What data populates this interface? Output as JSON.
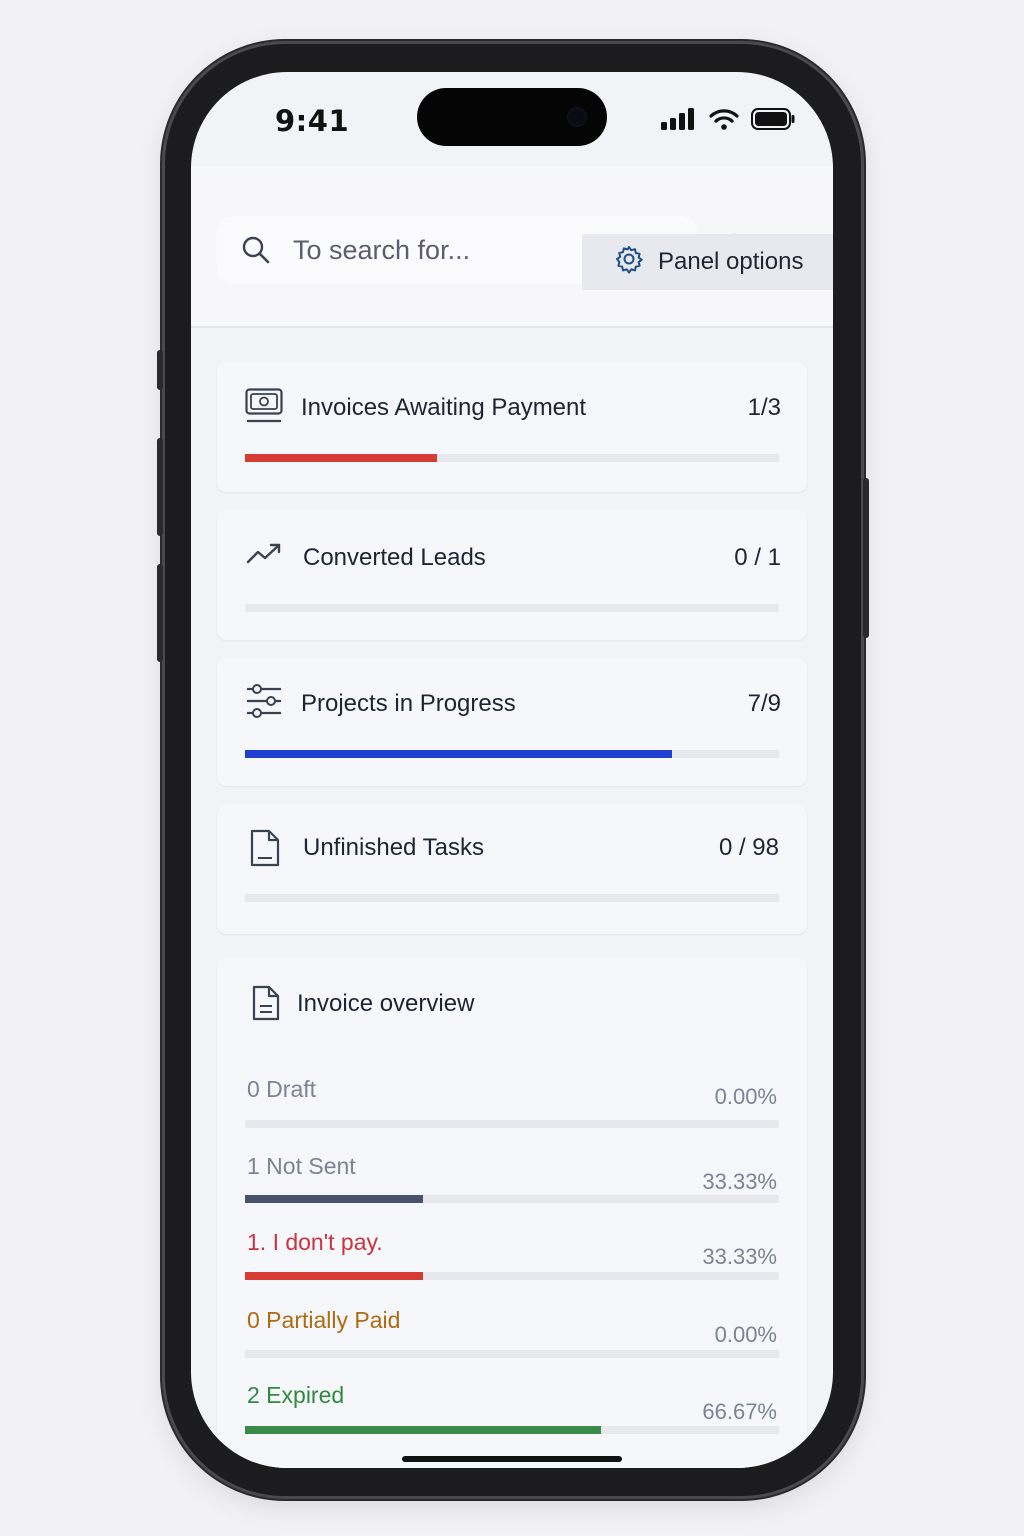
{
  "status_bar": {
    "time": "9:41"
  },
  "search": {
    "placeholder": "To search for..."
  },
  "panel_options": {
    "label": "Panel options"
  },
  "stats": [
    {
      "title": "Invoices Awaiting Payment",
      "count": "1/3",
      "progress": 0.36,
      "color": "#d63c36",
      "icon": "money-icon"
    },
    {
      "title": "Converted Leads",
      "count": "0 / 1",
      "progress": 0.0,
      "color": "#d63c36",
      "icon": "trending-up-icon"
    },
    {
      "title": "Projects in Progress",
      "count": "7/9",
      "progress": 0.8,
      "color": "#1e3fcf",
      "icon": "sliders-icon"
    },
    {
      "title": "Unfinished Tasks",
      "count": "0 / 98",
      "progress": 0.0,
      "color": "#1e3fcf",
      "icon": "file-icon"
    }
  ],
  "invoice_overview": {
    "title": "Invoice overview",
    "rows": [
      {
        "label": "0 Draft",
        "percent": "0.00%",
        "value": 0.0,
        "text_color": "#7b8394",
        "bar_color": "#48526a"
      },
      {
        "label": "1 Not Sent",
        "percent": "33.33%",
        "value": 0.3333,
        "text_color": "#7b8394",
        "bar_color": "#48526a"
      },
      {
        "label": "1. I don't pay.",
        "percent": "33.33%",
        "value": 0.3333,
        "text_color": "#cc3340",
        "bar_color": "#d63c36"
      },
      {
        "label": "0 Partially Paid",
        "percent": "0.00%",
        "value": 0.0,
        "text_color": "#b06a12",
        "bar_color": "#b06a12"
      },
      {
        "label": "2 Expired",
        "percent": "66.67%",
        "value": 0.6667,
        "text_color": "#2f8a3f",
        "bar_color": "#3a8a4a"
      }
    ]
  }
}
